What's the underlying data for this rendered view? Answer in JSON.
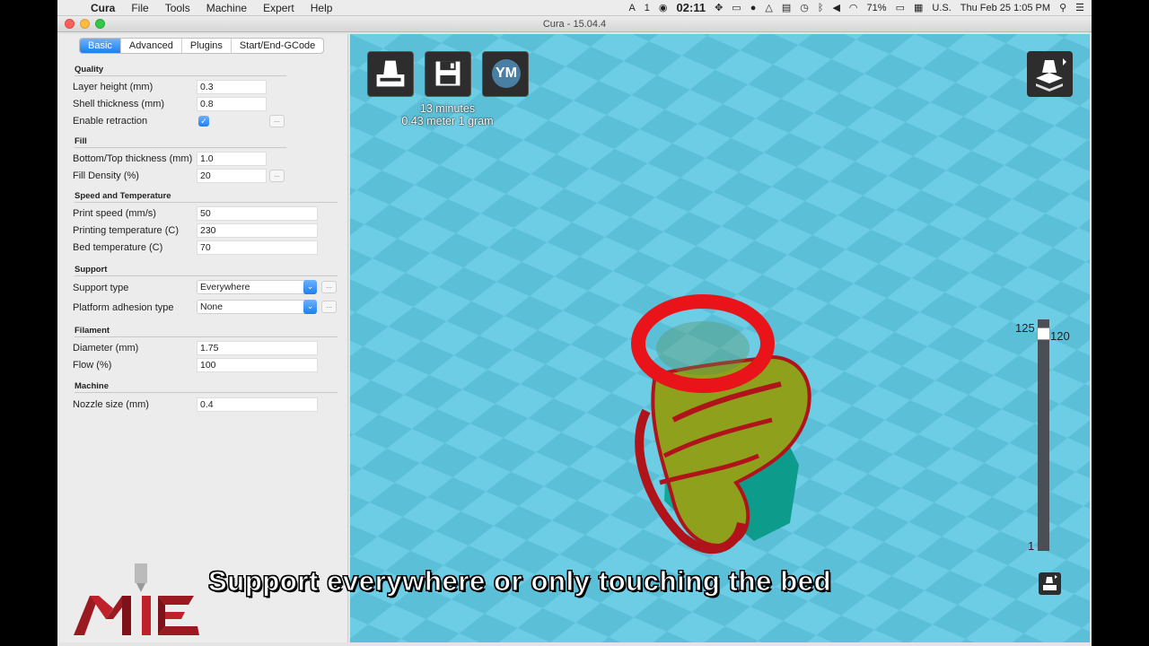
{
  "menubar": {
    "app_name": "Cura",
    "items": [
      "File",
      "Tools",
      "Machine",
      "Expert",
      "Help"
    ],
    "status": {
      "timer": "02:11",
      "battery": "71%",
      "input_source": "U.S.",
      "datetime": "Thu Feb 25  1:05 PM",
      "badge": "1"
    }
  },
  "window": {
    "title": "Cura - 15.04.4"
  },
  "tabs": [
    {
      "label": "Basic",
      "active": true
    },
    {
      "label": "Advanced",
      "active": false
    },
    {
      "label": "Plugins",
      "active": false
    },
    {
      "label": "Start/End-GCode",
      "active": false
    }
  ],
  "sections": {
    "quality": "Quality",
    "fill": "Fill",
    "speed": "Speed and Temperature",
    "support": "Support",
    "filament": "Filament",
    "machine": "Machine"
  },
  "settings": {
    "layer_height": {
      "label": "Layer height (mm)",
      "value": "0.3"
    },
    "shell_thickness": {
      "label": "Shell thickness (mm)",
      "value": "0.8"
    },
    "retraction": {
      "label": "Enable retraction",
      "checked": true
    },
    "bottom_top": {
      "label": "Bottom/Top thickness (mm)",
      "value": "1.0"
    },
    "fill_density": {
      "label": "Fill Density (%)",
      "value": "20"
    },
    "print_speed": {
      "label": "Print speed (mm/s)",
      "value": "50"
    },
    "print_temp": {
      "label": "Printing temperature (C)",
      "value": "230"
    },
    "bed_temp": {
      "label": "Bed temperature (C)",
      "value": "70"
    },
    "support_type": {
      "label": "Support type",
      "value": "Everywhere"
    },
    "adhesion": {
      "label": "Platform adhesion type",
      "value": "None"
    },
    "diameter": {
      "label": "Diameter (mm)",
      "value": "1.75"
    },
    "flow": {
      "label": "Flow (%)",
      "value": "100"
    },
    "nozzle": {
      "label": "Nozzle size (mm)",
      "value": "0.4"
    }
  },
  "dots_label": "...",
  "viewport": {
    "print_time": "13 minutes",
    "print_material": "0.43 meter 1 gram",
    "ym_label": "YM",
    "layer_max": "125",
    "layer_current": "120",
    "layer_min": "1",
    "layer_fraction": 0.96
  },
  "subtitle": "Support everywhere or only touching the bed",
  "colors": {
    "accent": "#1f7ef3",
    "bed": "#6dcde5",
    "bed_dark": "#5bbfd8",
    "model_red": "#e8141a",
    "model_green": "#8ea01c",
    "support_teal": "#0d9c8c"
  }
}
